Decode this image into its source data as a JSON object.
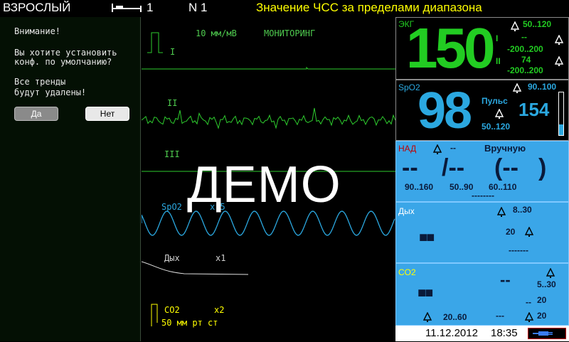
{
  "topbar": {
    "patient_mode": "ВЗРОСЛЫЙ",
    "bed_number": "1",
    "network": "N 1",
    "alarm_message": "Значение ЧСС за пределами диапазона"
  },
  "dialog": {
    "line1": "Внимание!",
    "line2": "Вы хотите установить",
    "line3": "конф. по умолчанию?",
    "line4": "Все тренды",
    "line5": "будут удалены!",
    "yes_label": "Да",
    "no_label": "Нет"
  },
  "waves": {
    "scale": "10 мм/мВ",
    "mode": "МОНИТОРИНГ",
    "lead1": "I",
    "lead2": "II",
    "lead3": "III",
    "spo2_label": "SpO2",
    "spo2_extra": "x 5",
    "resp_label": "Дых",
    "resp_gain": "x1",
    "co2_label": "CO2",
    "co2_gain": "x2",
    "co2_scale": "50 мм рт ст",
    "watermark": "ДЕМО"
  },
  "ecg": {
    "label": "ЭКГ",
    "hr": "150",
    "limits": "50..120",
    "lead_i": "I",
    "lead_ii": "II",
    "st1_value": "--",
    "st1_limits": "-200..200",
    "st2_value": "74",
    "st2_limits": "-200..200"
  },
  "spo2": {
    "label": "SpO2",
    "value": "98",
    "limits": "90..100",
    "pulse_label": "Пульс",
    "pulse_value": "154",
    "pulse_limits": "50..120",
    "perfusion_level": 0.25
  },
  "nibp": {
    "label": "НАД",
    "alarm_value": "--",
    "mode": "Вручную",
    "sys": "--",
    "dia": "/--",
    "mean": "(--",
    "close": ")",
    "sys_limits": "90..160",
    "dia_limits": "50..90",
    "mean_limits": "60..110",
    "time": "--------"
  },
  "resp": {
    "label": "Дых",
    "limits": "8..30",
    "value_dashes": "■■",
    "apnea": "20",
    "dashes": "-------"
  },
  "co2": {
    "label": "CO2",
    "value_dashes": "■■",
    "etco2": "--",
    "et_limits": "5..30",
    "fi": "--",
    "fi_limit": "20",
    "rr_limits": "20..60",
    "rr": "---",
    "rr_limit": "20"
  },
  "status": {
    "date": "11.12.2012",
    "time": "18:35"
  },
  "colors": {
    "ecg": "#22cc22",
    "spo2": "#22b8e0",
    "alarm": "#ffff00",
    "panel_blue": "#3aa6e8"
  }
}
